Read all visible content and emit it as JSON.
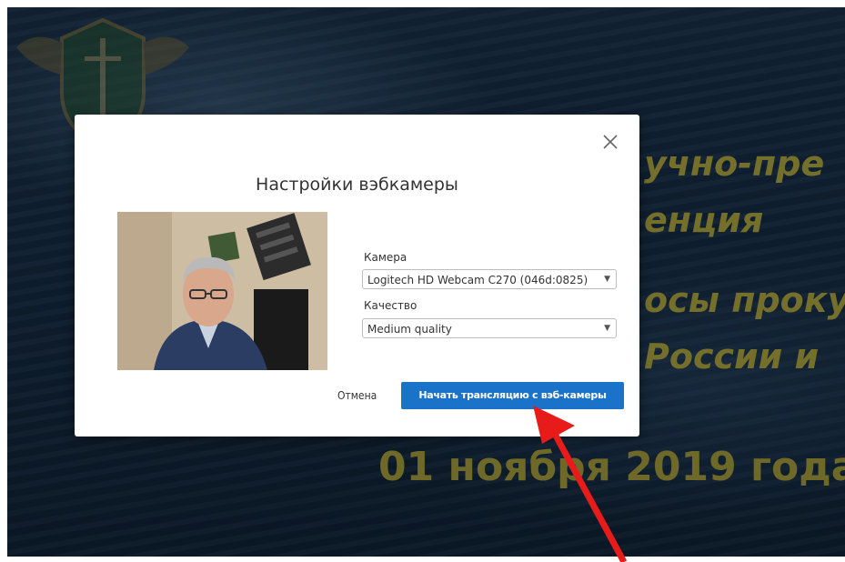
{
  "background": {
    "line1": "учно-пре",
    "line2": "енция",
    "line3": "осы проку",
    "line4": "России и",
    "date": "01 ноября 2019 года"
  },
  "modal": {
    "title": "Настройки вэбкамеры",
    "close_icon": "close-icon",
    "camera_label": "Камера",
    "camera_value": "Logitech HD Webcam C270 (046d:0825)",
    "quality_label": "Качество",
    "quality_value": "Medium quality",
    "dropdown_icon": "▼",
    "cancel_label": "Отмена",
    "start_label": "Начать трансляцию с вэб-камеры"
  },
  "colors": {
    "primary_button": "#1a73c9",
    "background_text": "#c8c04a",
    "annotation_arrow": "#e81b1b"
  }
}
